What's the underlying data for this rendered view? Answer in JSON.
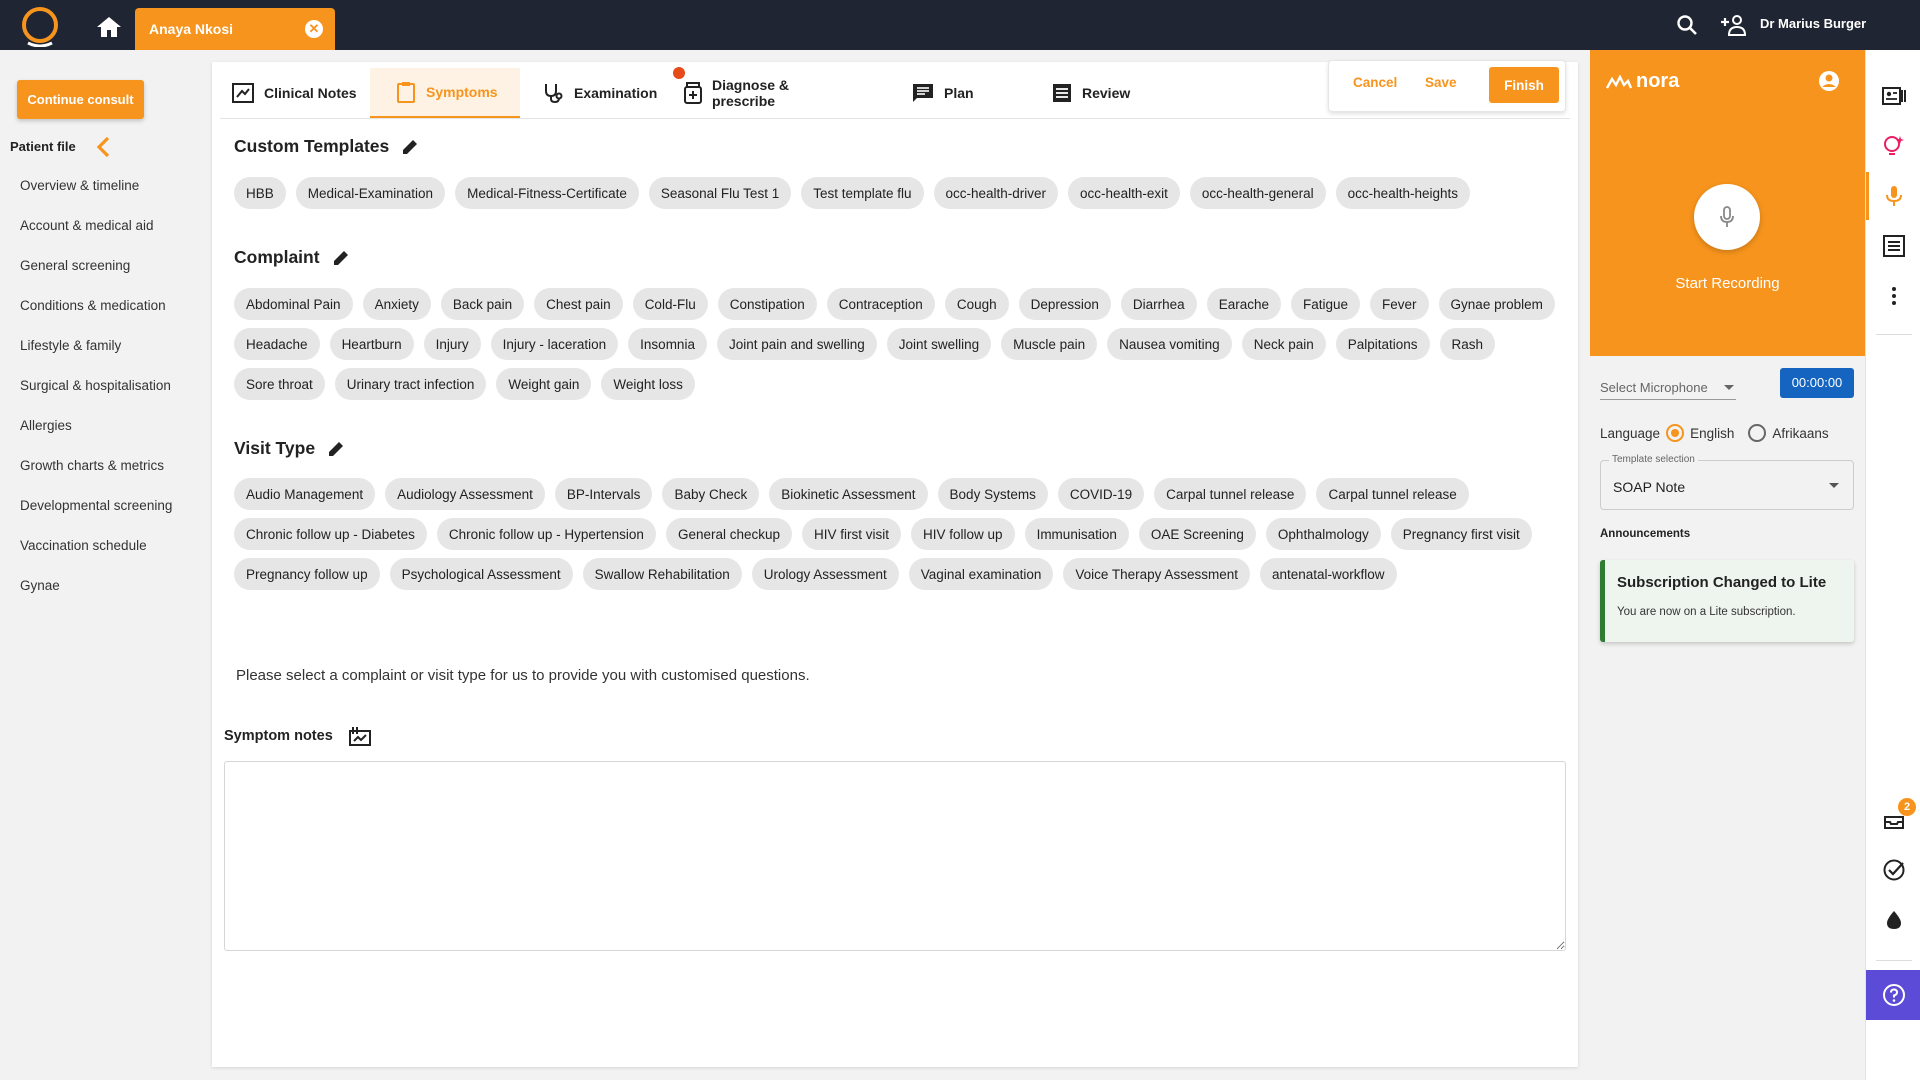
{
  "topbar": {
    "patient_tab_name": "Anaya Nkosi",
    "user_name": "Dr Marius Burger"
  },
  "sidebar": {
    "continue_label": "Continue consult",
    "patient_file_label": "Patient file",
    "items": [
      "Overview & timeline",
      "Account & medical aid",
      "General screening",
      "Conditions & medication",
      "Lifestyle & family",
      "Surgical & hospitalisation",
      "Allergies",
      "Growth charts & metrics",
      "Developmental screening",
      "Vaccination schedule",
      "Gynae"
    ]
  },
  "tabs": {
    "clinical_notes": "Clinical Notes",
    "symptoms": "Symptoms",
    "examination": "Examination",
    "diagnose": "Diagnose & prescribe",
    "plan": "Plan",
    "review": "Review",
    "active": "symptoms"
  },
  "actions": {
    "cancel": "Cancel",
    "save": "Save",
    "finish": "Finish"
  },
  "custom_templates": {
    "title": "Custom Templates",
    "chips": [
      "HBB",
      "Medical-Examination",
      "Medical-Fitness-Certificate",
      "Seasonal Flu Test 1",
      "Test template flu",
      "occ-health-driver",
      "occ-health-exit",
      "occ-health-general",
      "occ-health-heights"
    ]
  },
  "complaint": {
    "title": "Complaint",
    "chips": [
      "Abdominal Pain",
      "Anxiety",
      "Back pain",
      "Chest pain",
      "Cold-Flu",
      "Constipation",
      "Contraception",
      "Cough",
      "Depression",
      "Diarrhea",
      "Earache",
      "Fatigue",
      "Fever",
      "Gynae problem",
      "Headache",
      "Heartburn",
      "Injury",
      "Injury - laceration",
      "Insomnia",
      "Joint pain and swelling",
      "Joint swelling",
      "Muscle pain",
      "Nausea vomiting",
      "Neck pain",
      "Palpitations",
      "Rash",
      "Sore throat",
      "Urinary tract infection",
      "Weight gain",
      "Weight loss"
    ]
  },
  "visit_type": {
    "title": "Visit Type",
    "chips": [
      "Audio Management",
      "Audiology Assessment",
      "BP-Intervals",
      "Baby Check",
      "Biokinetic Assessment",
      "Body Systems",
      "COVID-19",
      "Carpal tunnel release",
      "Carpal tunnel release",
      "Chronic follow up - Diabetes",
      "Chronic follow up - Hypertension",
      "General checkup",
      "HIV first visit",
      "HIV follow up",
      "Immunisation",
      "OAE Screening",
      "Ophthalmology",
      "Pregnancy first visit",
      "Pregnancy follow up",
      "Psychological Assessment",
      "Swallow Rehabilitation",
      "Urology Assessment",
      "Vaginal examination",
      "Voice Therapy Assessment",
      "antenatal-workflow"
    ]
  },
  "info_text": "Please select a complaint or visit type for us to provide you with customised questions.",
  "symptom_notes": {
    "title": "Symptom notes",
    "value": ""
  },
  "nora": {
    "logo_text": "nora",
    "start_recording": "Start Recording",
    "mic_placeholder": "Select Microphone",
    "timer": "00:00:00",
    "language_label": "Language",
    "lang_english": "English",
    "lang_afrikaans": "Afrikaans",
    "selected_language": "English",
    "template_label": "Template selection",
    "template_value": "SOAP Note",
    "announcements_title": "Announcements",
    "announcement_title": "Subscription Changed to Lite",
    "announcement_body": "You are now on a Lite subscription."
  },
  "rail": {
    "notification_count": "2"
  },
  "colors": {
    "accent": "#f7941d",
    "topbar": "#1f2532",
    "timer_blue": "#1565c0",
    "help_purple": "#5c4bd6",
    "announcement_green": "#2e7d32"
  }
}
